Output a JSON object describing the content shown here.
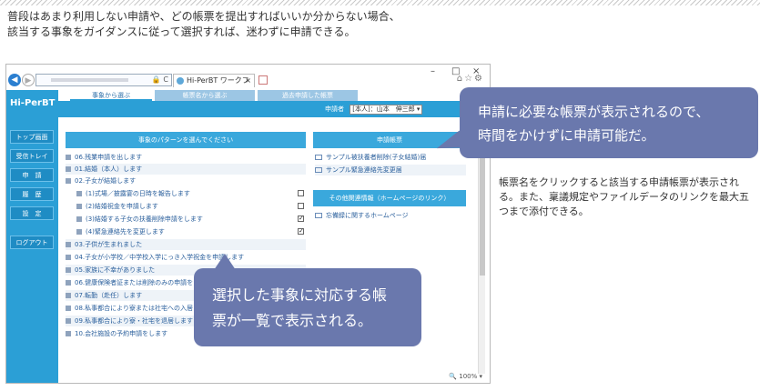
{
  "intro": {
    "line1": "普段はあまり利用しない申請や、どの帳票を提出すればいいか分からない場合、",
    "line2": "該当する事象をガイダンスに従って選択すれば、迷わずに申請できる。"
  },
  "side_note": "帳票名をクリックすると該当する申請帳票が表示される。また、稟議規定やファイルデータのリンクを最大五つまで添付できる。",
  "callout_top": {
    "line1": "申請に必要な帳票が表示されるので、",
    "line2": "時間をかけずに申請可能だ。"
  },
  "callout_bottom": {
    "line1": "選択した事象に対応する帳",
    "line2": "票が一覧で表示される。"
  },
  "browser": {
    "window_controls": [
      "–",
      "□",
      "×"
    ],
    "url_lock": "🔒 C",
    "tab_label": "Hi-PerBT ワークフロー",
    "tab_close": "×",
    "icons": "⌂☆⚙",
    "zoom": "🔍 100%  ▾"
  },
  "app": {
    "brand": "Hi-PerBT",
    "tabs": [
      "事象から選ぶ",
      "帳票名から選ぶ",
      "過去申請した帳票"
    ],
    "applicant_label": "申請者",
    "applicant_value": "[本人]：山本　伸三郎 ▾",
    "sidebar": [
      "トップ画面",
      "受信トレイ",
      "申　請",
      "履　歴",
      "設　定",
      "ログアウト"
    ],
    "event_panel_title": "事象のパターンを選んでください",
    "events": [
      "06.残業申請を出します",
      "01.結婚（本人）します",
      "02.子女が結婚します",
      "(1)式場／披露宴の日時を報告します",
      "(2)結婚祝金を申請します",
      "(3)結婚する子女の扶養削除申請をします",
      "(4)緊急連絡先を変更します",
      "03.子供が生まれました",
      "04.子女が小学校／中学校入学にっき入学祝金を申請します",
      "05.家族に不幸がありました",
      "06.健康保険者証または削除のみの申請をします",
      "07.転勤（赴任）します",
      "08.私事都合により寮または社宅への入居",
      "09.私事都合により寮・社宅を退居します",
      "10.会社施設の予約申請をします"
    ],
    "checks": [
      "",
      "",
      "✓",
      "✓"
    ],
    "forms_panel_title": "申請帳票",
    "forms": [
      "サンプル被扶養者削除(子女結婚)届",
      "サンプル緊急連絡先変更届"
    ],
    "links_panel_title": "その他関連情報（ホームページのリンク）",
    "links": [
      "忘備録に関するホームページ"
    ]
  }
}
